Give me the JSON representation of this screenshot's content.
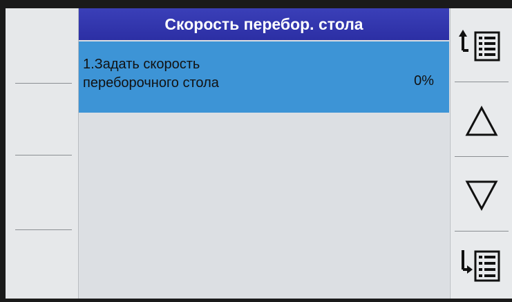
{
  "header": {
    "title": "Скорость перебор. стола"
  },
  "menu": {
    "items": [
      {
        "label_line1": "1.Задать скорость",
        "label_line2": "переборочного стола",
        "value": "0%"
      }
    ]
  },
  "softkeys_right": [
    {
      "icon": "page-up-list-icon"
    },
    {
      "icon": "triangle-up-icon"
    },
    {
      "icon": "triangle-down-icon"
    },
    {
      "icon": "page-down-list-icon"
    }
  ],
  "colors": {
    "title_bar": "#2f33a8",
    "selected_row": "#3d94d6",
    "background": "#dcdfe3"
  }
}
